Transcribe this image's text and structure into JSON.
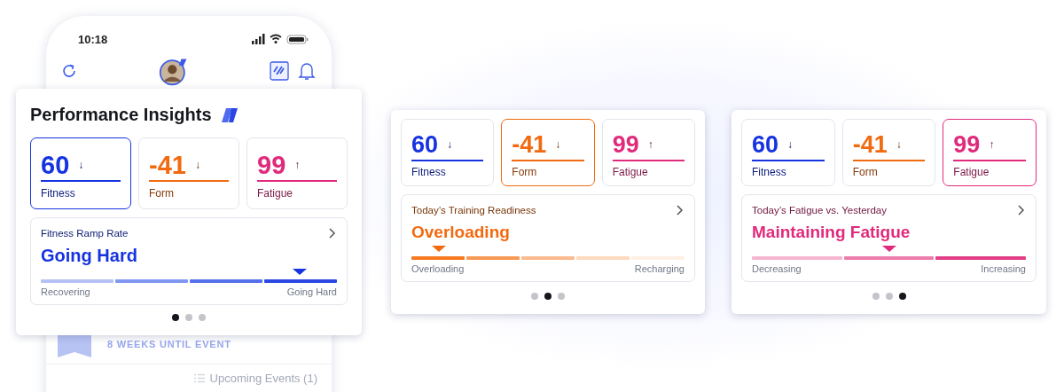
{
  "phone": {
    "time": "10:18",
    "event_countdown": "8 WEEKS UNTIL EVENT",
    "upcoming_events": "Upcoming Events (1)"
  },
  "cards": [
    {
      "kind": "overlay",
      "title": "Performance Insights",
      "metrics": [
        {
          "value": "60",
          "trend": "↓",
          "label": "Fitness",
          "color": "#1633e0",
          "selected": true
        },
        {
          "value": "-41",
          "trend": "↓",
          "label": "Form",
          "color": "#f26a0f",
          "selected": false
        },
        {
          "value": "99",
          "trend": "↑",
          "label": "Fatigue",
          "color": "#e02a7c",
          "selected": false
        }
      ],
      "insight": {
        "heading": "Fitness Ramp Rate",
        "status": "Going Hard",
        "color": "#1633e0",
        "level": 0.875,
        "segments": [
          {
            "color": "#b5c1f5"
          },
          {
            "color": "#8096f0"
          },
          {
            "color": "#5470ea"
          },
          {
            "color": "#2a47e3"
          }
        ],
        "left_label": "Recovering",
        "right_label": "Going Hard"
      },
      "pages": [
        {
          "selected": true
        },
        {
          "selected": false
        },
        {
          "selected": false
        }
      ]
    },
    {
      "kind": "plain",
      "metrics": [
        {
          "value": "60",
          "trend": "↓",
          "label": "Fitness",
          "color": "#1633e0",
          "selected": false
        },
        {
          "value": "-41",
          "trend": "↓",
          "label": "Form",
          "color": "#f26a0f",
          "selected": true
        },
        {
          "value": "99",
          "trend": "↑",
          "label": "Fatigue",
          "color": "#e02a7c",
          "selected": false
        }
      ],
      "insight": {
        "heading": "Today’s Training Readiness",
        "status": "Overloading",
        "color": "#f26a0f",
        "level": 0.1,
        "segments": [
          {
            "color": "#f57a20"
          },
          {
            "color": "#f89a55"
          },
          {
            "color": "#fbbb8e"
          },
          {
            "color": "#fdd9bd"
          },
          {
            "color": "#fff0e4"
          }
        ],
        "left_label": "Overloading",
        "right_label": "Recharging"
      },
      "pages": [
        {
          "selected": false
        },
        {
          "selected": true
        },
        {
          "selected": false
        }
      ]
    },
    {
      "kind": "plain",
      "metrics": [
        {
          "value": "60",
          "trend": "↓",
          "label": "Fitness",
          "color": "#1633e0",
          "selected": false
        },
        {
          "value": "-41",
          "trend": "↓",
          "label": "Form",
          "color": "#f26a0f",
          "selected": false
        },
        {
          "value": "99",
          "trend": "↑",
          "label": "Fatigue",
          "color": "#e02a7c",
          "selected": true
        }
      ],
      "insight": {
        "heading": "Today’s Fatigue vs. Yesterday",
        "status": "Maintaining Fatigue",
        "color": "#e02a7c",
        "level": 0.5,
        "segments": [
          {
            "color": "#f6b6d0"
          },
          {
            "color": "#ec7cac"
          },
          {
            "color": "#e33f87"
          }
        ],
        "left_label": "Decreasing",
        "right_label": "Increasing"
      },
      "pages": [
        {
          "selected": false
        },
        {
          "selected": false
        },
        {
          "selected": true
        }
      ]
    }
  ]
}
